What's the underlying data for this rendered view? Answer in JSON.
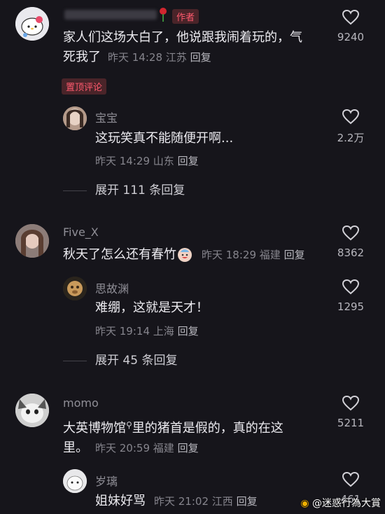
{
  "comments": [
    {
      "name": "",
      "author_badge": "作者",
      "text_line1": "家人们这场大白了，他说跟我闹着玩的，气",
      "text_line2": "死我了",
      "time": "昨天 14:28",
      "location": "江苏",
      "reply_label": "回复",
      "likes": "9240",
      "pinned_badge": "置顶评论",
      "replies": [
        {
          "name": "宝宝",
          "text": "这玩笑真不能随便开啊...",
          "time": "昨天 14:29",
          "location": "山东",
          "reply_label": "回复",
          "likes": "2.2万"
        }
      ],
      "expand_label": "展开 111 条回复"
    },
    {
      "name": "Five_X",
      "text": "秋天了怎么还有春竹",
      "time": "昨天 18:29",
      "location": "福建",
      "reply_label": "回复",
      "likes": "8362",
      "replies": [
        {
          "name": "思故渊",
          "text": "难绷，这就是天才！",
          "time": "昨天 19:14",
          "location": "上海",
          "reply_label": "回复",
          "likes": "1295"
        }
      ],
      "expand_label": "展开 45 条回复"
    },
    {
      "name": "momo",
      "text_line1": "大英博物馆",
      "text_line1_suffix": "里的猪首是假的，真的在这",
      "text_line2": "里。",
      "time": "昨天 20:59",
      "location": "福建",
      "reply_label": "回复",
      "likes": "5211",
      "replies": [
        {
          "name": "岁璃",
          "text": "姐妹好骂",
          "time": "昨天 21:02",
          "location": "江西",
          "reply_label": "回复",
          "likes": "461"
        }
      ]
    }
  ],
  "watermark": "@迷惑行為大賞",
  "colors": {
    "background": "#16151b",
    "badge": "#ff5a6e"
  }
}
